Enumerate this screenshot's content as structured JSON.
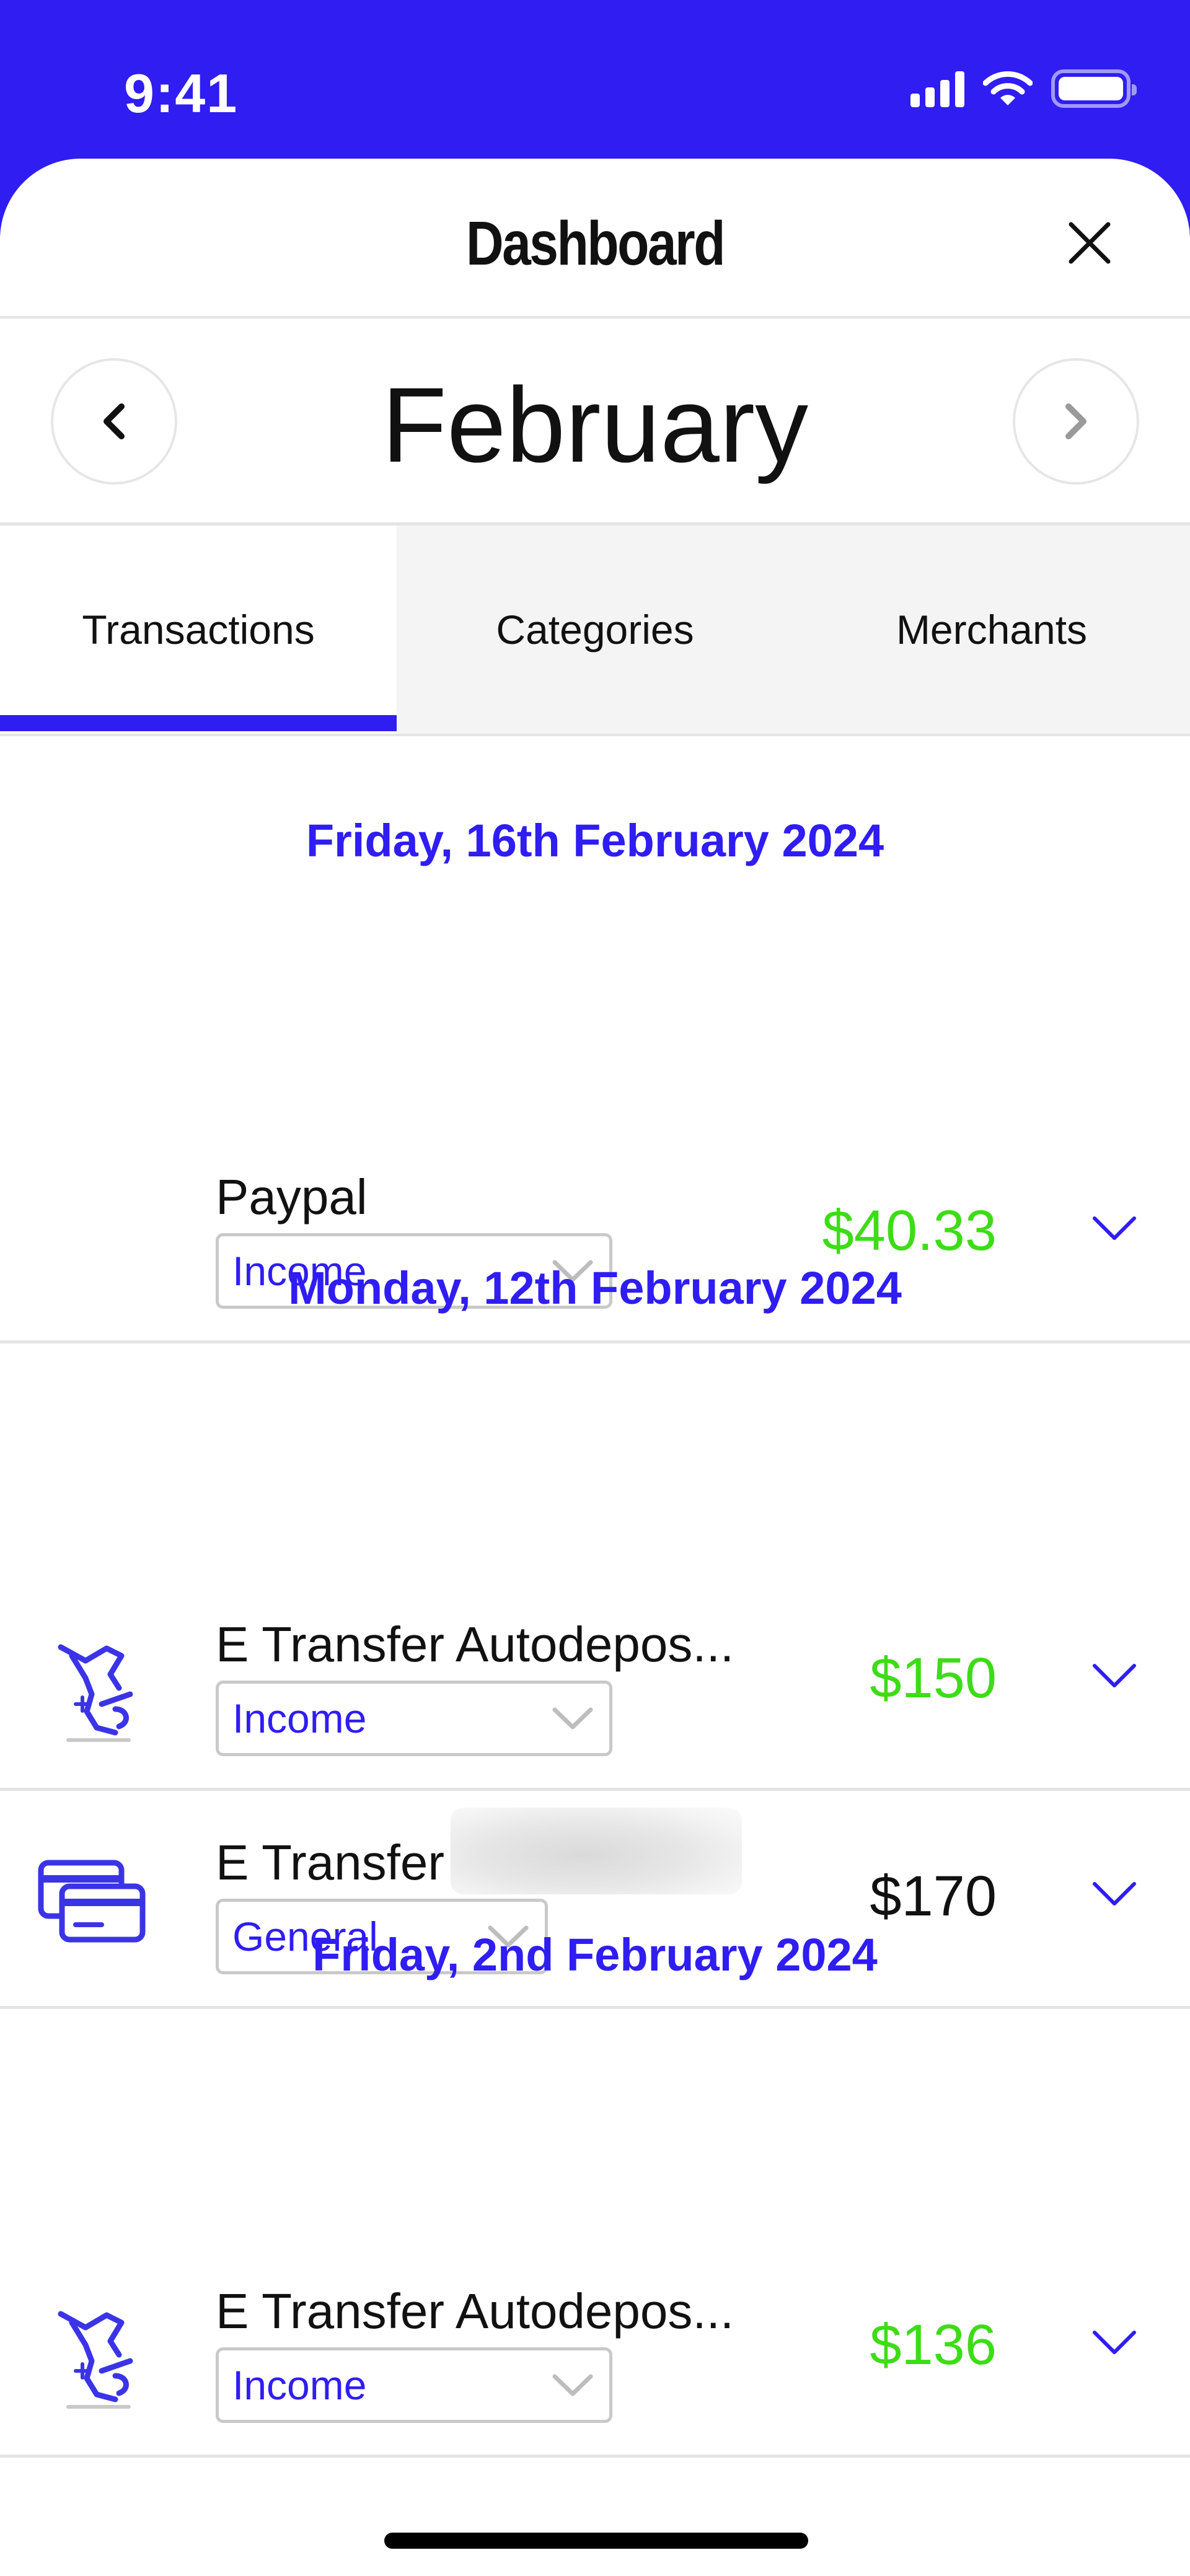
{
  "status_bar": {
    "time": "9:41"
  },
  "header": {
    "title": "Dashboard"
  },
  "month_nav": {
    "label": "February"
  },
  "tabs": [
    {
      "label": "Transactions",
      "active": true
    },
    {
      "label": "Categories",
      "active": false
    },
    {
      "label": "Merchants",
      "active": false
    }
  ],
  "groups": [
    {
      "date": "Friday, 16th February 2024",
      "transactions": [
        {
          "merchant": "Paypal",
          "category": "Income",
          "amount": "$40.33",
          "amount_color": "#3ddc17",
          "icon": "none"
        }
      ]
    },
    {
      "date": "Monday, 12th February 2024",
      "transactions": [
        {
          "merchant": "E Transfer Autodepos...",
          "category": "Income",
          "amount": "$150",
          "amount_color": "#3ddc17",
          "icon": "income-money-icon"
        },
        {
          "merchant": "E Transfer",
          "category": "General",
          "amount": "$170",
          "amount_color": "#111111",
          "icon": "credit-cards-icon"
        }
      ]
    },
    {
      "date": "Friday, 2nd February 2024",
      "transactions": [
        {
          "merchant": "E Transfer Autodepos...",
          "category": "Income",
          "amount": "$136",
          "amount_color": "#3ddc17",
          "icon": "income-money-icon"
        }
      ]
    }
  ],
  "colors": {
    "accent": "#2f1df2",
    "income": "#3ddc17",
    "divider": "#e3e4e3"
  }
}
